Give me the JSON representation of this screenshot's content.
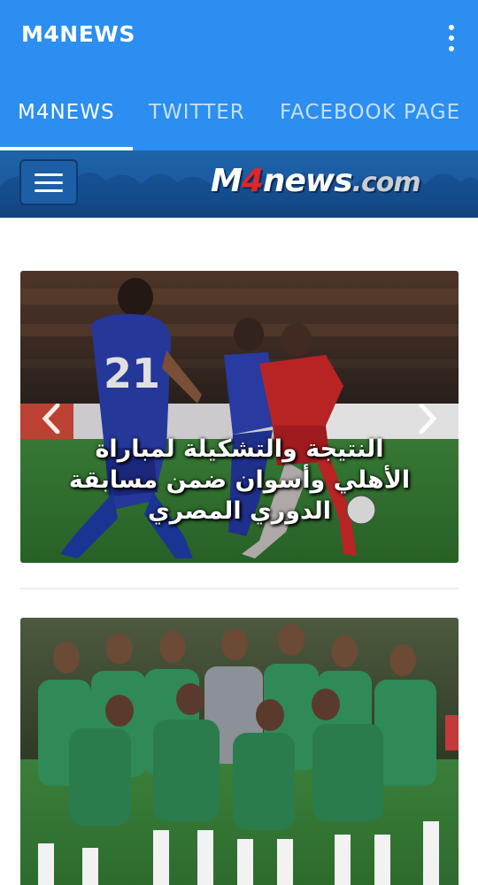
{
  "app": {
    "title": "M4NEWS"
  },
  "tabs": [
    {
      "label": "M4NEWS",
      "active": true
    },
    {
      "label": "TWITTER",
      "active": false
    },
    {
      "label": "FACEBOOK PAGE",
      "active": false
    }
  ],
  "site_header": {
    "logo_m": "M",
    "logo_four": "4",
    "logo_news": "news",
    "logo_dotcom": ".com"
  },
  "slider": {
    "title": "النتيجة والتشكيلة لمباراة الأهلي وأسوان ضمن مسابقة الدوري المصري",
    "shirt_number": "21"
  },
  "icons": {
    "overflow": "more-vert-icon",
    "menu": "hamburger-menu-icon",
    "prev": "chevron-left-icon",
    "next": "chevron-right-icon"
  },
  "colors": {
    "appbar": "#2b8ef0",
    "header": "#1e63a8",
    "logo_accent": "#e0262a"
  }
}
